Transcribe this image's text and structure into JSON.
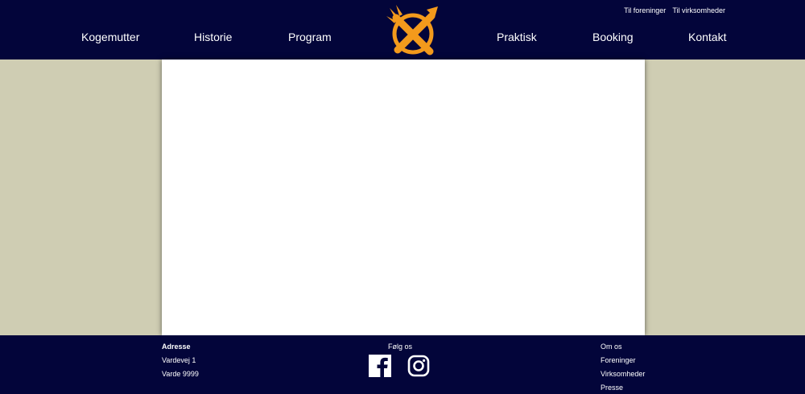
{
  "header": {
    "top_links": [
      "Til foreninger",
      "Til virksomheder"
    ],
    "nav": [
      "Kogemutter",
      "Historie",
      "Program",
      "Praktisk",
      "Booking",
      "Kontakt"
    ]
  },
  "footer": {
    "address": {
      "title": "Adresse",
      "line1": "Vardevej 1",
      "line2": "Varde 9999"
    },
    "follow": {
      "title": "Følg os"
    },
    "links": [
      "Om os",
      "Foreninger",
      "Virksomheder",
      "Presse"
    ]
  },
  "colors": {
    "navy": "#03053a",
    "beige": "#cfcdb3",
    "logo_orange": "#f39a1c"
  },
  "icons": [
    "logo-icon",
    "facebook-icon",
    "instagram-icon"
  ]
}
